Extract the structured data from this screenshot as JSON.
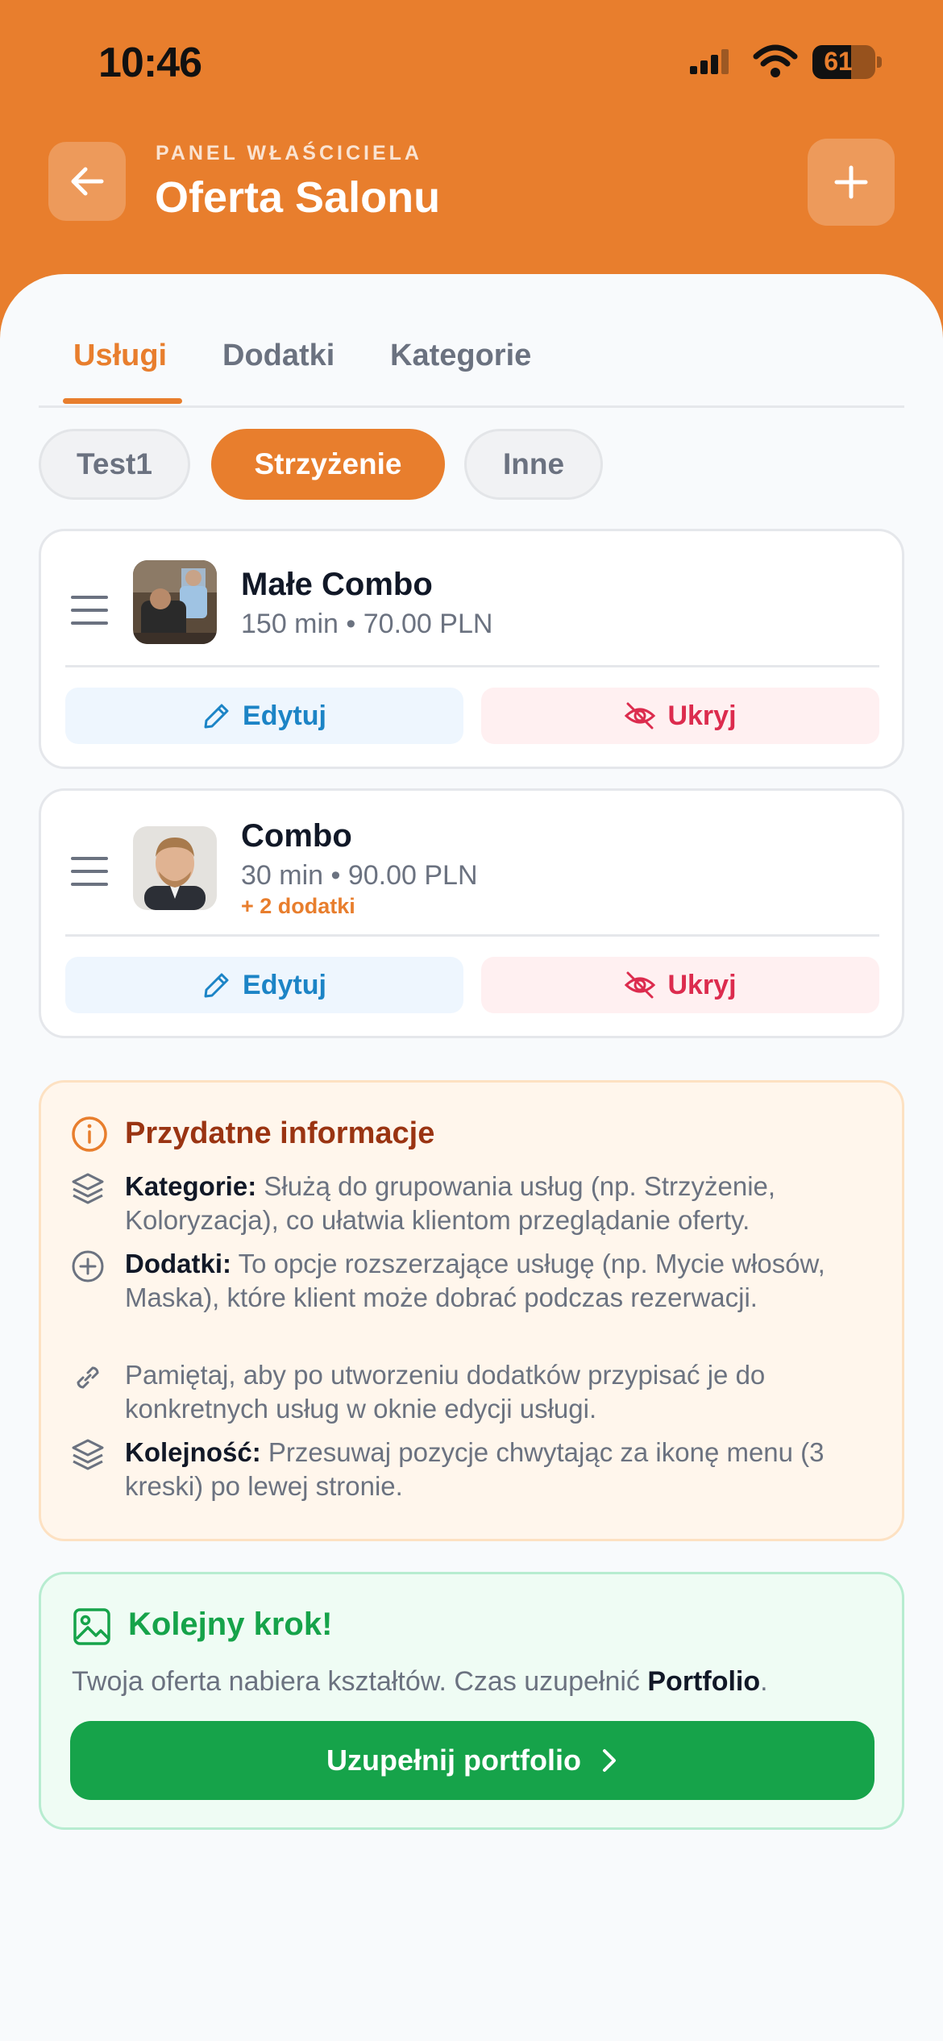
{
  "status": {
    "time": "10:46",
    "battery": "61",
    "battery_level": 0.61
  },
  "header": {
    "subtitle": "PANEL WŁAŚCICIELA",
    "title": "Oferta Salonu"
  },
  "tabs": [
    {
      "label": "Usługi",
      "active": true
    },
    {
      "label": "Dodatki",
      "active": false
    },
    {
      "label": "Kategorie",
      "active": false
    }
  ],
  "filters": [
    {
      "label": "Test1",
      "active": false
    },
    {
      "label": "Strzyżenie",
      "active": true
    },
    {
      "label": "Inne",
      "active": false
    }
  ],
  "services": [
    {
      "name": "Małe Combo",
      "meta": "150 min • 70.00 PLN",
      "extra": "",
      "edit_label": "Edytuj",
      "hide_label": "Ukryj"
    },
    {
      "name": "Combo",
      "meta": "30 min • 90.00 PLN",
      "extra": "+ 2 dodatki",
      "edit_label": "Edytuj",
      "hide_label": "Ukryj"
    }
  ],
  "info": {
    "title": "Przydatne informacje",
    "items": [
      {
        "icon": "layers-icon",
        "bold": "Kategorie:",
        "text": " Służą do grupowania usług (np. Strzyżenie, Koloryzacja), co ułatwia klientom przeglądanie oferty."
      },
      {
        "icon": "plus-circle-icon",
        "bold": "Dodatki:",
        "text": " To opcje rozszerzające usługę (np. Mycie włosów, Maska), które klient może dobrać podczas rezerwacji."
      },
      {
        "icon": "link-icon",
        "bold": "",
        "text": "Pamiętaj, aby po utworzeniu dodatków przypisać je do konkretnych usług w oknie edycji usługi."
      },
      {
        "icon": "layers-icon",
        "bold": "Kolejność:",
        "text": " Przesuwaj pozycje chwytając za ikonę menu (3 kreski) po lewej stronie."
      }
    ]
  },
  "next_step": {
    "title": "Kolejny krok!",
    "text_before": "Twoja oferta nabiera kształtów. Czas uzupełnić ",
    "text_bold": "Portfolio",
    "text_after": ".",
    "button": "Uzupełnij portfolio"
  },
  "colors": {
    "accent": "#e87e2d",
    "edit": "#1c84c6",
    "hide": "#dc2c4e",
    "success": "#16a34a"
  }
}
